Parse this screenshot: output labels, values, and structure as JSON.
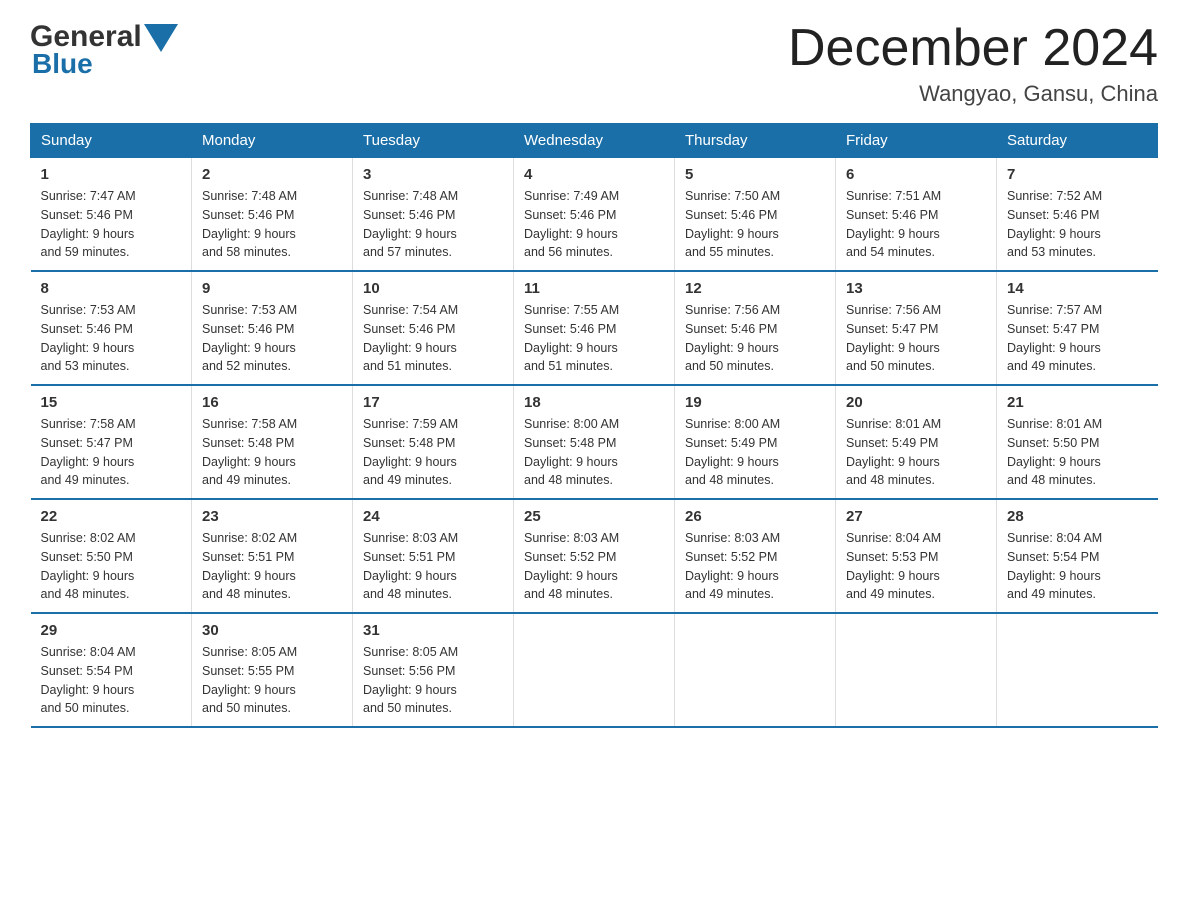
{
  "logo": {
    "general": "General",
    "blue": "Blue",
    "tagline": ""
  },
  "title": {
    "month_year": "December 2024",
    "location": "Wangyao, Gansu, China"
  },
  "weekdays": [
    "Sunday",
    "Monday",
    "Tuesday",
    "Wednesday",
    "Thursday",
    "Friday",
    "Saturday"
  ],
  "weeks": [
    [
      {
        "day": "1",
        "sunrise": "7:47 AM",
        "sunset": "5:46 PM",
        "daylight": "9 hours and 59 minutes."
      },
      {
        "day": "2",
        "sunrise": "7:48 AM",
        "sunset": "5:46 PM",
        "daylight": "9 hours and 58 minutes."
      },
      {
        "day": "3",
        "sunrise": "7:48 AM",
        "sunset": "5:46 PM",
        "daylight": "9 hours and 57 minutes."
      },
      {
        "day": "4",
        "sunrise": "7:49 AM",
        "sunset": "5:46 PM",
        "daylight": "9 hours and 56 minutes."
      },
      {
        "day": "5",
        "sunrise": "7:50 AM",
        "sunset": "5:46 PM",
        "daylight": "9 hours and 55 minutes."
      },
      {
        "day": "6",
        "sunrise": "7:51 AM",
        "sunset": "5:46 PM",
        "daylight": "9 hours and 54 minutes."
      },
      {
        "day": "7",
        "sunrise": "7:52 AM",
        "sunset": "5:46 PM",
        "daylight": "9 hours and 53 minutes."
      }
    ],
    [
      {
        "day": "8",
        "sunrise": "7:53 AM",
        "sunset": "5:46 PM",
        "daylight": "9 hours and 53 minutes."
      },
      {
        "day": "9",
        "sunrise": "7:53 AM",
        "sunset": "5:46 PM",
        "daylight": "9 hours and 52 minutes."
      },
      {
        "day": "10",
        "sunrise": "7:54 AM",
        "sunset": "5:46 PM",
        "daylight": "9 hours and 51 minutes."
      },
      {
        "day": "11",
        "sunrise": "7:55 AM",
        "sunset": "5:46 PM",
        "daylight": "9 hours and 51 minutes."
      },
      {
        "day": "12",
        "sunrise": "7:56 AM",
        "sunset": "5:46 PM",
        "daylight": "9 hours and 50 minutes."
      },
      {
        "day": "13",
        "sunrise": "7:56 AM",
        "sunset": "5:47 PM",
        "daylight": "9 hours and 50 minutes."
      },
      {
        "day": "14",
        "sunrise": "7:57 AM",
        "sunset": "5:47 PM",
        "daylight": "9 hours and 49 minutes."
      }
    ],
    [
      {
        "day": "15",
        "sunrise": "7:58 AM",
        "sunset": "5:47 PM",
        "daylight": "9 hours and 49 minutes."
      },
      {
        "day": "16",
        "sunrise": "7:58 AM",
        "sunset": "5:48 PM",
        "daylight": "9 hours and 49 minutes."
      },
      {
        "day": "17",
        "sunrise": "7:59 AM",
        "sunset": "5:48 PM",
        "daylight": "9 hours and 49 minutes."
      },
      {
        "day": "18",
        "sunrise": "8:00 AM",
        "sunset": "5:48 PM",
        "daylight": "9 hours and 48 minutes."
      },
      {
        "day": "19",
        "sunrise": "8:00 AM",
        "sunset": "5:49 PM",
        "daylight": "9 hours and 48 minutes."
      },
      {
        "day": "20",
        "sunrise": "8:01 AM",
        "sunset": "5:49 PM",
        "daylight": "9 hours and 48 minutes."
      },
      {
        "day": "21",
        "sunrise": "8:01 AM",
        "sunset": "5:50 PM",
        "daylight": "9 hours and 48 minutes."
      }
    ],
    [
      {
        "day": "22",
        "sunrise": "8:02 AM",
        "sunset": "5:50 PM",
        "daylight": "9 hours and 48 minutes."
      },
      {
        "day": "23",
        "sunrise": "8:02 AM",
        "sunset": "5:51 PM",
        "daylight": "9 hours and 48 minutes."
      },
      {
        "day": "24",
        "sunrise": "8:03 AM",
        "sunset": "5:51 PM",
        "daylight": "9 hours and 48 minutes."
      },
      {
        "day": "25",
        "sunrise": "8:03 AM",
        "sunset": "5:52 PM",
        "daylight": "9 hours and 48 minutes."
      },
      {
        "day": "26",
        "sunrise": "8:03 AM",
        "sunset": "5:52 PM",
        "daylight": "9 hours and 49 minutes."
      },
      {
        "day": "27",
        "sunrise": "8:04 AM",
        "sunset": "5:53 PM",
        "daylight": "9 hours and 49 minutes."
      },
      {
        "day": "28",
        "sunrise": "8:04 AM",
        "sunset": "5:54 PM",
        "daylight": "9 hours and 49 minutes."
      }
    ],
    [
      {
        "day": "29",
        "sunrise": "8:04 AM",
        "sunset": "5:54 PM",
        "daylight": "9 hours and 50 minutes."
      },
      {
        "day": "30",
        "sunrise": "8:05 AM",
        "sunset": "5:55 PM",
        "daylight": "9 hours and 50 minutes."
      },
      {
        "day": "31",
        "sunrise": "8:05 AM",
        "sunset": "5:56 PM",
        "daylight": "9 hours and 50 minutes."
      },
      null,
      null,
      null,
      null
    ]
  ],
  "labels": {
    "sunrise": "Sunrise:",
    "sunset": "Sunset:",
    "daylight": "Daylight:"
  },
  "colors": {
    "header_bg": "#1a6fa8",
    "header_text": "#ffffff",
    "border": "#1a6fa8"
  }
}
